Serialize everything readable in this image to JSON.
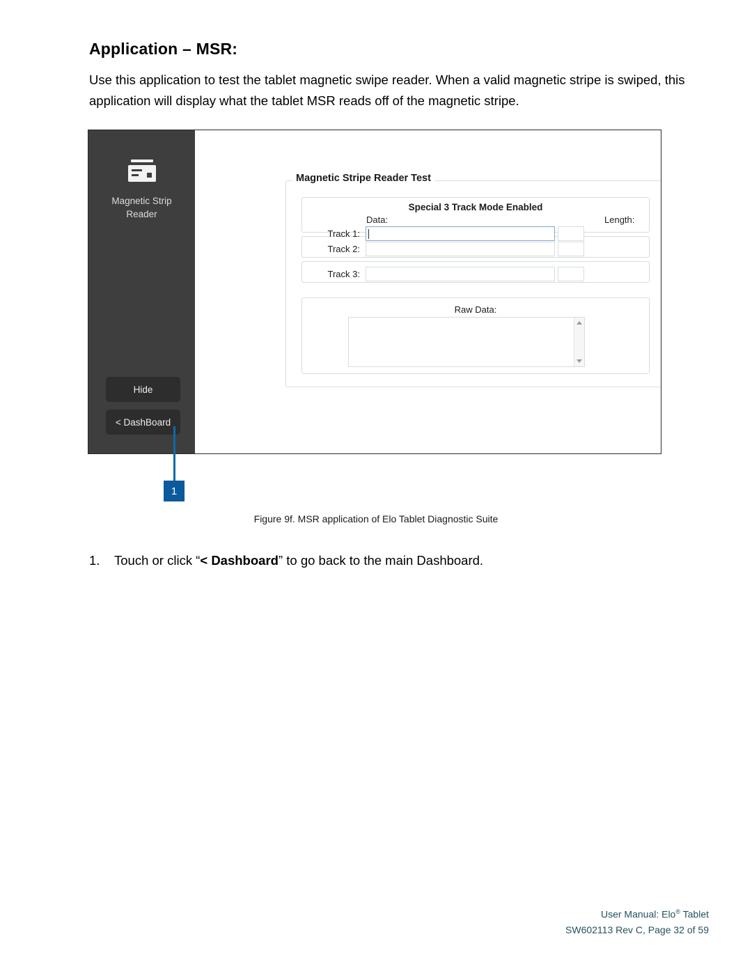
{
  "document": {
    "title": "Application – MSR:",
    "intro": "Use this application to test the tablet magnetic swipe reader. When a valid magnetic stripe is swiped, this application will display what the tablet MSR reads off of the magnetic stripe.",
    "figure_caption": "Figure 9f. MSR application of Elo Tablet Diagnostic Suite",
    "step": {
      "number": "1.",
      "text_before": "Touch or click “",
      "bold": "< Dashboard",
      "text_after": "” to go back to the main Dashboard."
    },
    "footer": {
      "line1_before": "User Manual: Elo",
      "line1_sup": "®",
      "line1_after": " Tablet",
      "line2": "SW602113 Rev C, Page 32 of 59"
    }
  },
  "callout": {
    "badge_number": "1",
    "color": "#0b5a9c"
  },
  "screenshot": {
    "sidebar": {
      "icon_name": "magnetic-stripe-card-icon",
      "app_label_line1": "Magnetic Strip",
      "app_label_line2": "Reader",
      "buttons": [
        {
          "label": "Hide"
        },
        {
          "label": "< DashBoard"
        }
      ],
      "background_color": "#3e3e3e",
      "button_color": "#2d2d2d"
    },
    "main": {
      "groupbox_title": "Magnetic Stripe Reader Test",
      "mode_title": "Special 3 Track Mode Enabled",
      "column_headers": {
        "data": "Data:",
        "length": "Length:"
      },
      "tracks": [
        {
          "label": "Track 1:",
          "value": "",
          "length": "",
          "focused": true
        },
        {
          "label": "Track 2:",
          "value": "",
          "length": "",
          "focused": false
        },
        {
          "label": "Track 3:",
          "value": "",
          "length": "",
          "focused": false
        }
      ],
      "raw_data_label": "Raw Data:",
      "raw_data_value": ""
    }
  }
}
